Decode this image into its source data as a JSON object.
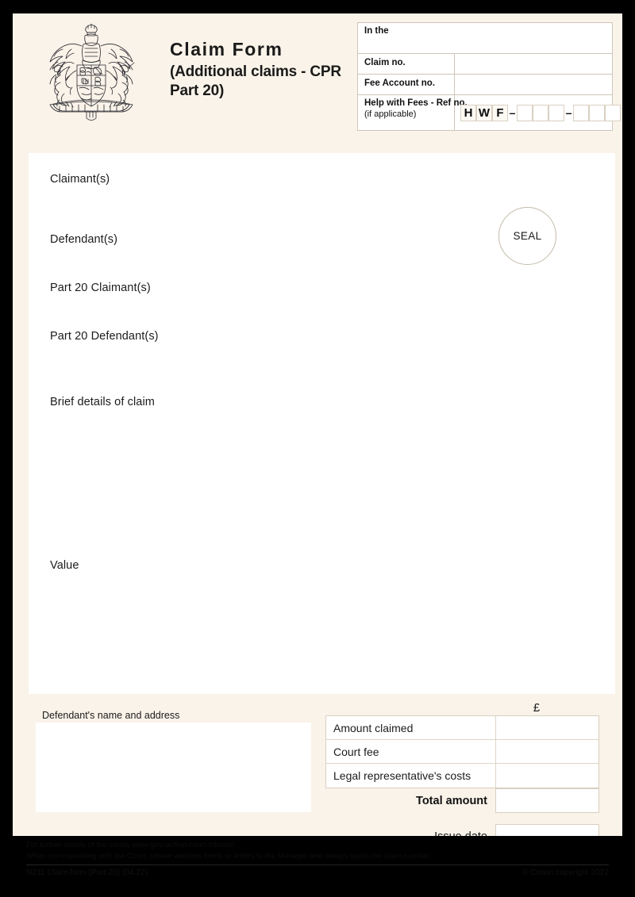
{
  "header": {
    "crest_icon": "royal-coat-of-arms",
    "title_main": "Claim Form",
    "title_sub": "(Additional claims - CPR Part 20)",
    "fields": {
      "in_the_label": "In the",
      "in_the_value": "",
      "claim_no_label": "Claim no.",
      "claim_no_value": "",
      "fee_account_label": "Fee Account no.",
      "fee_account_value": "",
      "hwf_label": "Help with Fees - Ref no.",
      "hwf_note": "(if applicable)",
      "hwf_prefix": [
        "H",
        "W",
        "F"
      ],
      "hwf_dash": "–",
      "hwf_group1": [
        "",
        "",
        ""
      ],
      "hwf_group2": [
        "",
        "",
        ""
      ]
    }
  },
  "body": {
    "labels": {
      "claimants": "Claimant(s)",
      "defendants": "Defendant(s)",
      "part20_claimants": "Part 20 Claimant(s)",
      "part20_defendants": "Part 20 Defendant(s)",
      "brief_details": "Brief details of claim",
      "value": "Value"
    },
    "values": {
      "claimants": "",
      "defendants": "",
      "part20_claimants": "",
      "part20_defendants": "",
      "brief_details": "",
      "value": ""
    },
    "seal_label": "SEAL"
  },
  "lower": {
    "defendant_address_label": "Defendant's name and address",
    "defendant_address_value": "",
    "currency_symbol": "£",
    "money_rows": [
      {
        "label": "Amount claimed",
        "value": ""
      },
      {
        "label": "Court fee",
        "value": ""
      },
      {
        "label": "Legal representative's costs",
        "value": ""
      }
    ],
    "total_label": "Total amount",
    "total_value": "",
    "issue_date_label": "Issue date",
    "issue_date_value": ""
  },
  "footer": {
    "note_line1": "For further details of the courts www.gov.uk/find-court-tribunal.",
    "note_line2": "When corresponding with the Court, please address forms or letters to the Manager and always quote the claim number.",
    "form_code": "N211 Claim form (Part 20) (04.22)",
    "copyright": "© Crown copyright 2022"
  },
  "colors": {
    "page_background": "#faf3e9",
    "content_white": "#ffffff",
    "border": "#cfc6b8",
    "text": "#1b1b1b",
    "outer_frame": "#000000"
  }
}
